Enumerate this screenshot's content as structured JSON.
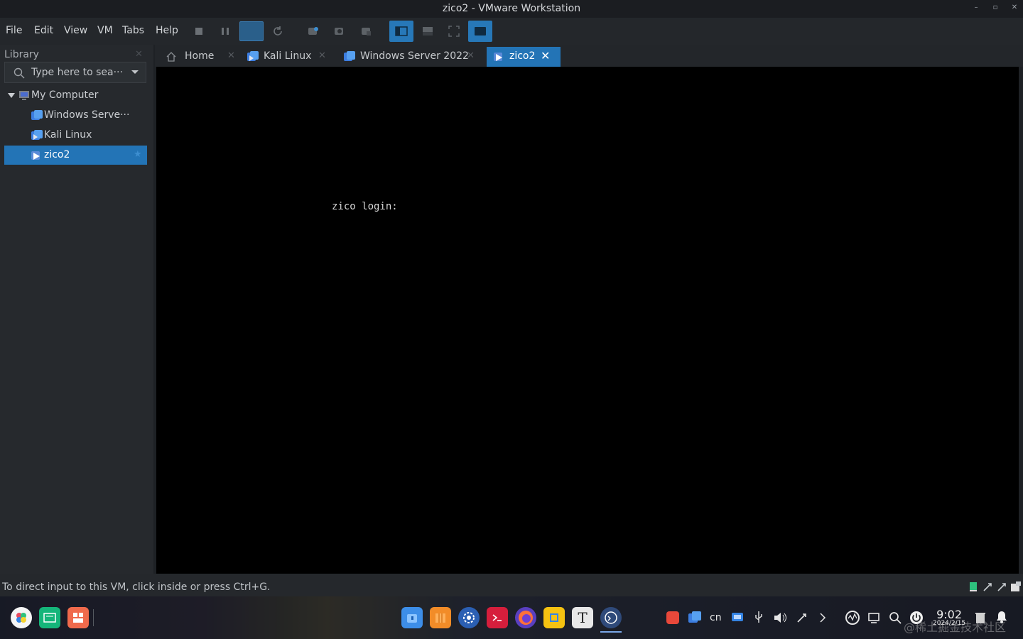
{
  "window": {
    "title": "zico2 - VMware Workstation",
    "controls": [
      "minimize-icon",
      "maximize-icon",
      "close-icon"
    ]
  },
  "menu": [
    "File",
    "Edit",
    "View",
    "VM",
    "Tabs",
    "Help"
  ],
  "toolbar": {
    "buttons": [
      {
        "name": "power-stop-icon",
        "active": false
      },
      {
        "name": "pause-icon",
        "active": false
      },
      {
        "name": "fit-guest-icon",
        "active": true
      },
      {
        "name": "refresh-icon",
        "active": false
      },
      {
        "name": "snapshot-take-icon",
        "active": false
      },
      {
        "name": "snapshot-revert-icon",
        "active": false
      },
      {
        "name": "snapshot-manager-icon",
        "active": false
      },
      {
        "name": "show-library-icon",
        "active": true
      },
      {
        "name": "thumbnail-bar-icon",
        "active": false
      },
      {
        "name": "full-screen-icon",
        "active": false
      },
      {
        "name": "console-view-icon",
        "active": true
      }
    ]
  },
  "library": {
    "header": "Library",
    "search_placeholder": "Type here to sea···",
    "tree": [
      {
        "label": "My Computer",
        "level": 0,
        "expanded": true,
        "icon": "computer-icon"
      },
      {
        "label": "Windows Serve···",
        "level": 1,
        "icon": "vm-windows-icon"
      },
      {
        "label": "Kali Linux",
        "level": 1,
        "icon": "vm-linux-icon"
      },
      {
        "label": "zico2",
        "level": 1,
        "icon": "vm-running-icon",
        "selected": true
      }
    ]
  },
  "tabs": [
    {
      "label": "Home",
      "icon": "home-icon",
      "active": false
    },
    {
      "label": "Kali Linux",
      "icon": "vm-icon",
      "active": false
    },
    {
      "label": "Windows Server 2022",
      "icon": "vm-icon",
      "active": false
    },
    {
      "label": "zico2",
      "icon": "vm-running-icon",
      "active": true
    }
  ],
  "console": {
    "text": "zico login:"
  },
  "status": {
    "message": "To direct input to this VM, click inside or press Ctrl+G.",
    "icons": [
      "hard-disk-icon",
      "network-icon",
      "usb-icon",
      "message-icon"
    ]
  },
  "taskbar": {
    "launchers": [
      "app-launcher-icon",
      "terminal-app-icon",
      "app-store-icon"
    ],
    "apps": [
      "file-manager-icon",
      "package-manager-icon",
      "settings-icon",
      "terminal-icon",
      "firefox-icon",
      "editor-icon",
      "typora-icon",
      "vmware-icon"
    ],
    "tray": [
      "sogou-input-icon",
      "vmware-tray-icon",
      "cn",
      "screenshot-icon",
      "usb-tray-icon",
      "volume-icon",
      "brightness-icon",
      "expand-tray-icon",
      "network-monitor-icon",
      "display-icon",
      "search-icon",
      "power-icon"
    ],
    "clock_time": "9:02",
    "clock_date": "2024/2/15",
    "notification_icons": [
      "trash-icon",
      "notification-bell-icon"
    ],
    "watermark": "@稀土掘金技术社区"
  }
}
